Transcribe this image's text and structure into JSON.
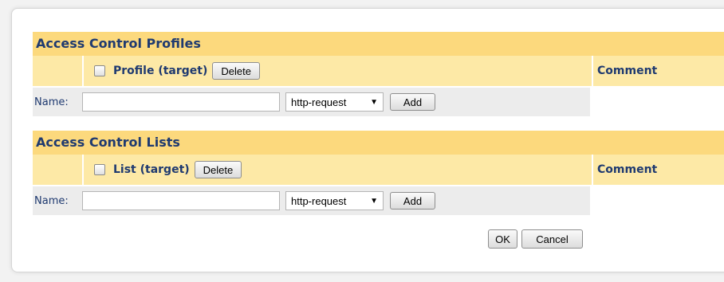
{
  "profiles": {
    "title": "Access Control Profiles",
    "target_label": "Profile (target)",
    "delete_label": "Delete",
    "comment_header": "Comment",
    "name_label": "Name:",
    "name_value": "",
    "type_value": "http-request",
    "add_label": "Add"
  },
  "lists": {
    "title": "Access Control Lists",
    "target_label": "List (target)",
    "delete_label": "Delete",
    "comment_header": "Comment",
    "name_label": "Name:",
    "name_value": "",
    "type_value": "http-request",
    "add_label": "Add"
  },
  "footer": {
    "ok_label": "OK",
    "cancel_label": "Cancel"
  },
  "colors": {
    "section_title_bg": "#fcd97d",
    "header_bg": "#fde9a6",
    "name_row_bg": "#ececec",
    "label_text": "#1f3a70"
  },
  "icons": {
    "dropdown": "chevron-down-icon"
  }
}
